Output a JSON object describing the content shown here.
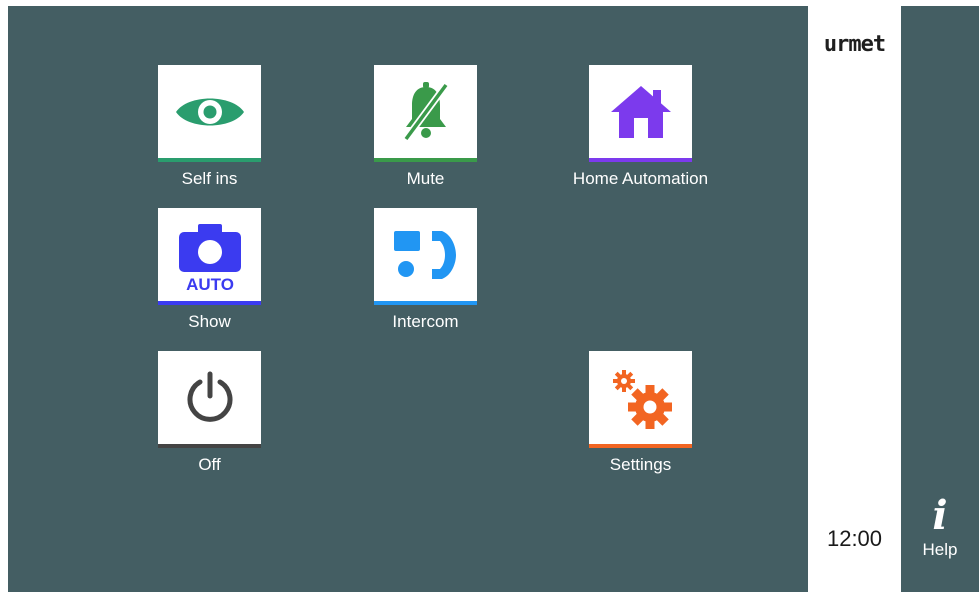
{
  "brand": {
    "logo_text": "urmet"
  },
  "status": {
    "time": "12:00"
  },
  "help": {
    "icon_glyph": "i",
    "label": "Help"
  },
  "tiles": {
    "self_ins": {
      "label": "Self ins",
      "icon": "eye-icon",
      "accent": "#2a9d6e"
    },
    "mute": {
      "label": "Mute",
      "icon": "bell-muted-icon",
      "accent": "#3a9a4a"
    },
    "home_automation": {
      "label": "Home Automation",
      "icon": "house-icon",
      "accent": "#7c3aed"
    },
    "show": {
      "label": "Show",
      "icon": "camera-auto-icon",
      "badge": "AUTO",
      "accent": "#3b3bf0"
    },
    "intercom": {
      "label": "Intercom",
      "icon": "intercom-handset-icon",
      "accent": "#2196f3"
    },
    "off": {
      "label": "Off",
      "icon": "power-icon",
      "accent": "#444444"
    },
    "settings": {
      "label": "Settings",
      "icon": "gears-icon",
      "accent": "#f26522"
    }
  },
  "colors": {
    "background": "#445e63",
    "sidebar": "#ffffff"
  }
}
